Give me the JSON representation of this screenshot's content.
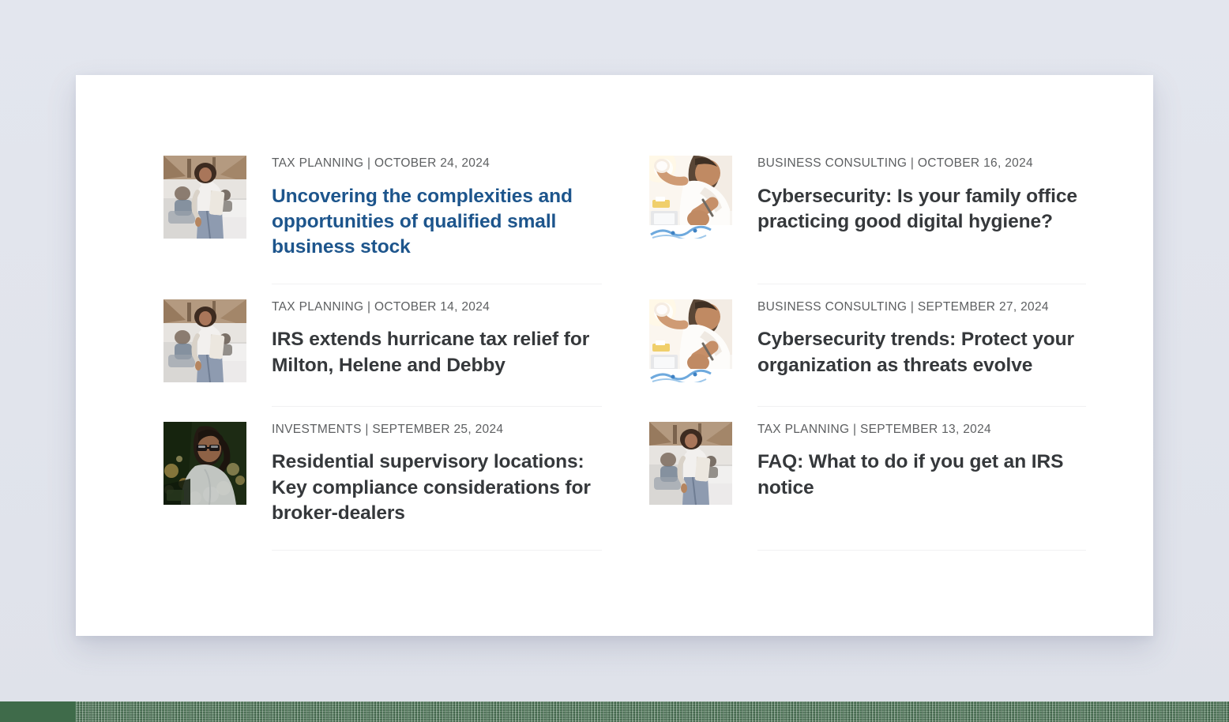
{
  "theme": {
    "page_background": "#e2e5ee",
    "card_background": "#ffffff",
    "meta_color": "#5d5f61",
    "title_color": "#35383b",
    "accent_title_color": "#1d558c",
    "divider_color": "#f1f1f2",
    "footer_band_color": "#3f6b4a"
  },
  "articles": [
    {
      "id": "qsbs",
      "column": "left",
      "row": 1,
      "meta": "TAX PLANNING | OCTOBER 24, 2024",
      "category": "TAX PLANNING",
      "date": "OCTOBER 24, 2024",
      "title": "Uncovering the complexities and opportunities of qualified small business stock",
      "accent": true,
      "thumbnail": "woman-standing-in-open-office-photo"
    },
    {
      "id": "cybersecurity-family-office",
      "column": "right",
      "row": 1,
      "meta": "BUSINESS CONSULTING | OCTOBER 16, 2024",
      "category": "BUSINESS CONSULTING",
      "date": "OCTOBER 16, 2024",
      "title": "Cybersecurity: Is your family office practicing good digital hygiene?",
      "accent": false,
      "thumbnail": "person-writing-at-desk-photo"
    },
    {
      "id": "irs-hurricane-relief",
      "column": "left",
      "row": 2,
      "meta": "TAX PLANNING | OCTOBER 14, 2024",
      "category": "TAX PLANNING",
      "date": "OCTOBER 14, 2024",
      "title": "IRS extends hurricane tax relief for Milton, Helene and Debby",
      "accent": false,
      "thumbnail": "woman-standing-in-open-office-photo"
    },
    {
      "id": "cybersecurity-trends",
      "column": "right",
      "row": 2,
      "meta": "BUSINESS CONSULTING | SEPTEMBER 27, 2024",
      "category": "BUSINESS CONSULTING",
      "date": "SEPTEMBER 27, 2024",
      "title": "Cybersecurity trends: Protect your organization as threats evolve",
      "accent": false,
      "thumbnail": "person-writing-at-desk-photo"
    },
    {
      "id": "residential-supervisory-locations",
      "column": "left",
      "row": 3,
      "meta": "INVESTMENTS | SEPTEMBER 25, 2024",
      "category": "INVESTMENTS",
      "date": "SEPTEMBER 25, 2024",
      "title": "Residential supervisory locations: Key compliance considerations for broker-dealers",
      "accent": false,
      "thumbnail": "woman-with-glasses-at-night-photo"
    },
    {
      "id": "faq-irs-notice",
      "column": "right",
      "row": 3,
      "meta": "TAX PLANNING | SEPTEMBER 13, 2024",
      "category": "TAX PLANNING",
      "date": "SEPTEMBER 13, 2024",
      "title": "FAQ: What to do if you get an IRS notice",
      "accent": false,
      "thumbnail": "woman-standing-in-open-office-photo"
    }
  ]
}
